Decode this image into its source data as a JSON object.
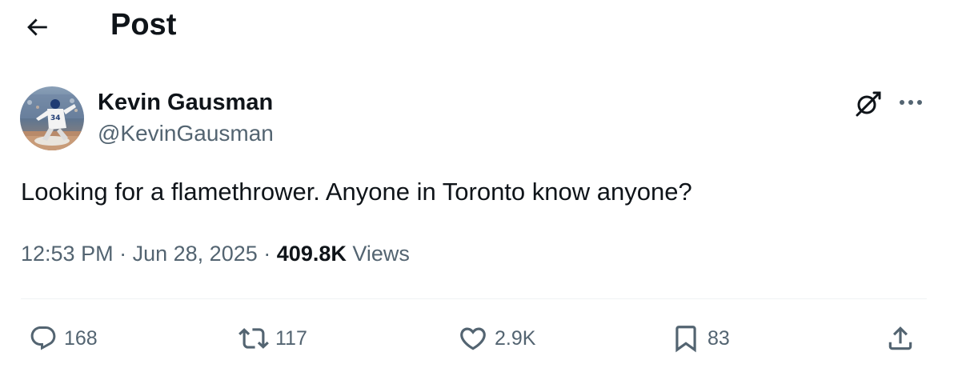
{
  "header": {
    "title": "Post",
    "back_icon": "arrow-left-icon"
  },
  "author": {
    "name": "Kevin Gausman",
    "handle": "@KevinGausman",
    "avatar_icon": "user-avatar"
  },
  "tweet": {
    "text": "Looking for a flamethrower. Anyone in Toronto know anyone?",
    "time": "12:53 PM",
    "separator": "·",
    "date": "Jun 28, 2025",
    "views_count": "409.8K",
    "views_label": "Views"
  },
  "actions": {
    "replies": "168",
    "reposts": "117",
    "likes": "2.9K",
    "bookmarks": "83"
  },
  "colors": {
    "text_primary": "#0f1419",
    "text_secondary": "#536471",
    "divider": "#eff3f4"
  }
}
